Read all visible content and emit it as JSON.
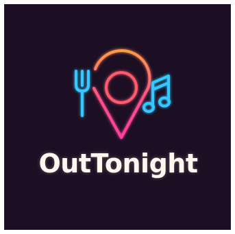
{
  "logo": {
    "brand_name": "OutTonight",
    "icons": [
      "fork-icon",
      "map-pin-icon",
      "plate-icon",
      "music-note-icon"
    ]
  },
  "colors": {
    "background": "#1c0f24",
    "text": "#fff8f0",
    "neon_blue": "#35c8ff",
    "neon_pink": "#ff3f8e",
    "neon_orange": "#ff8a4c"
  }
}
